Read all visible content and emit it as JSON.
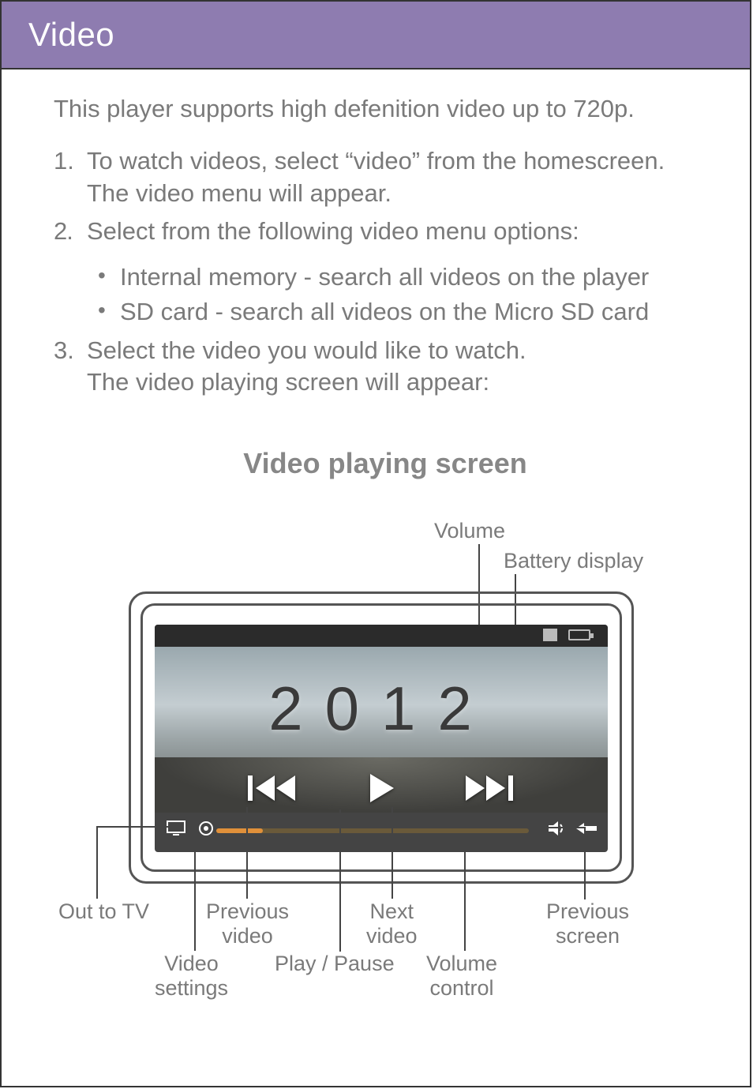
{
  "header": {
    "title": "Video"
  },
  "content": {
    "intro": "This player supports high defenition video up to 720p.",
    "steps": [
      {
        "num": "1.",
        "text": "To watch videos, select “video” from the homescreen.  The video menu will appear."
      },
      {
        "num": "2.",
        "text": "Select from the following video menu options:"
      },
      {
        "num": "3.",
        "text": "Select the video you would like to watch.\nThe video playing screen will appear:"
      }
    ],
    "bullets": [
      "Internal memory - search all videos on the player",
      "SD card - search all videos on the Micro SD card"
    ],
    "diagram_title": "Video playing screen"
  },
  "diagram": {
    "video_title": "2012",
    "labels": {
      "volume": "Volume",
      "battery": "Battery display",
      "out_to_tv": "Out to TV",
      "previous_video": "Previous\nvideo",
      "next_video": "Next\nvideo",
      "previous_screen": "Previous\nscreen",
      "video_settings": "Video\nsettings",
      "play_pause": "Play / Pause",
      "volume_control": "Volume\ncontrol"
    }
  }
}
